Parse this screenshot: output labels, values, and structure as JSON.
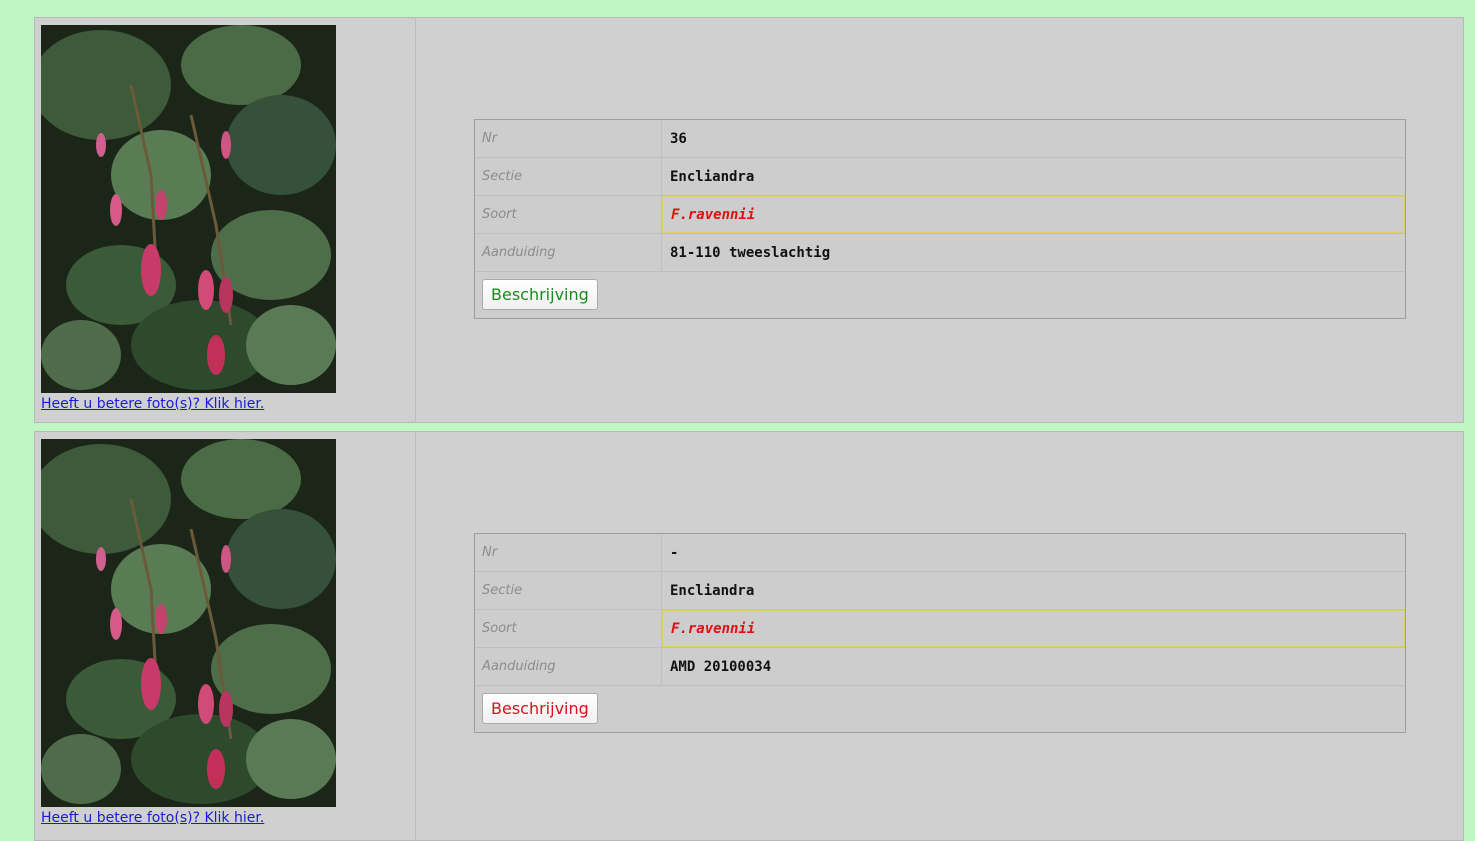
{
  "records": [
    {
      "photo_link": "Heeft u betere foto(s)? Klik hier.",
      "rows": [
        {
          "label": "Nr",
          "value": "36"
        },
        {
          "label": "Sectie",
          "value": "Encliandra"
        },
        {
          "label": "Soort",
          "value": "F.ravennii"
        },
        {
          "label": "Aanduiding",
          "value": "81-110 tweeslachtig"
        }
      ],
      "button_label": "Beschrijving",
      "button_color": "#1c8a1c"
    },
    {
      "photo_link": "Heeft u betere foto(s)? Klik hier.",
      "rows": [
        {
          "label": "Nr",
          "value": "-"
        },
        {
          "label": "Sectie",
          "value": "Encliandra"
        },
        {
          "label": "Soort",
          "value": "F.ravennii"
        },
        {
          "label": "Aanduiding",
          "value": "AMD 20100034"
        }
      ],
      "button_label": "Beschrijving",
      "button_color": "#d8101c"
    }
  ],
  "colors": {
    "page_bg": "#c2f5c4",
    "card_bg": "#d0d0d0",
    "species_text": "#e01010",
    "link": "#1a1ad9"
  }
}
